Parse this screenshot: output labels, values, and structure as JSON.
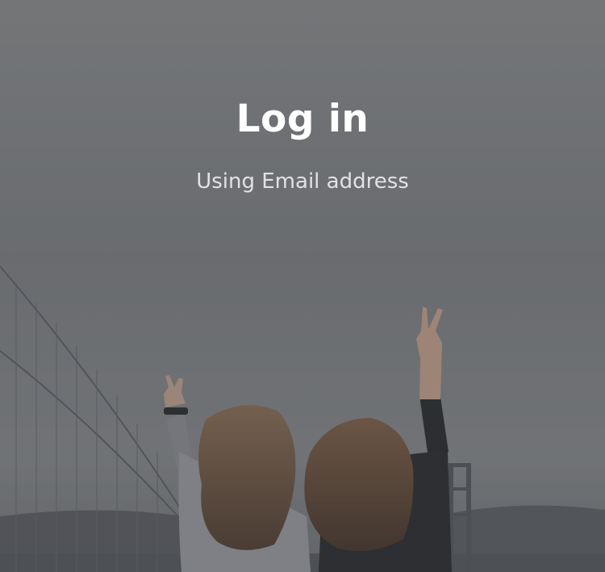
{
  "login": {
    "title": "Log in",
    "method_label": "Using Email address"
  },
  "background": {
    "subject": "two-friends-peace-sign-bridge-photo",
    "overlay_color": "#5f6165"
  }
}
